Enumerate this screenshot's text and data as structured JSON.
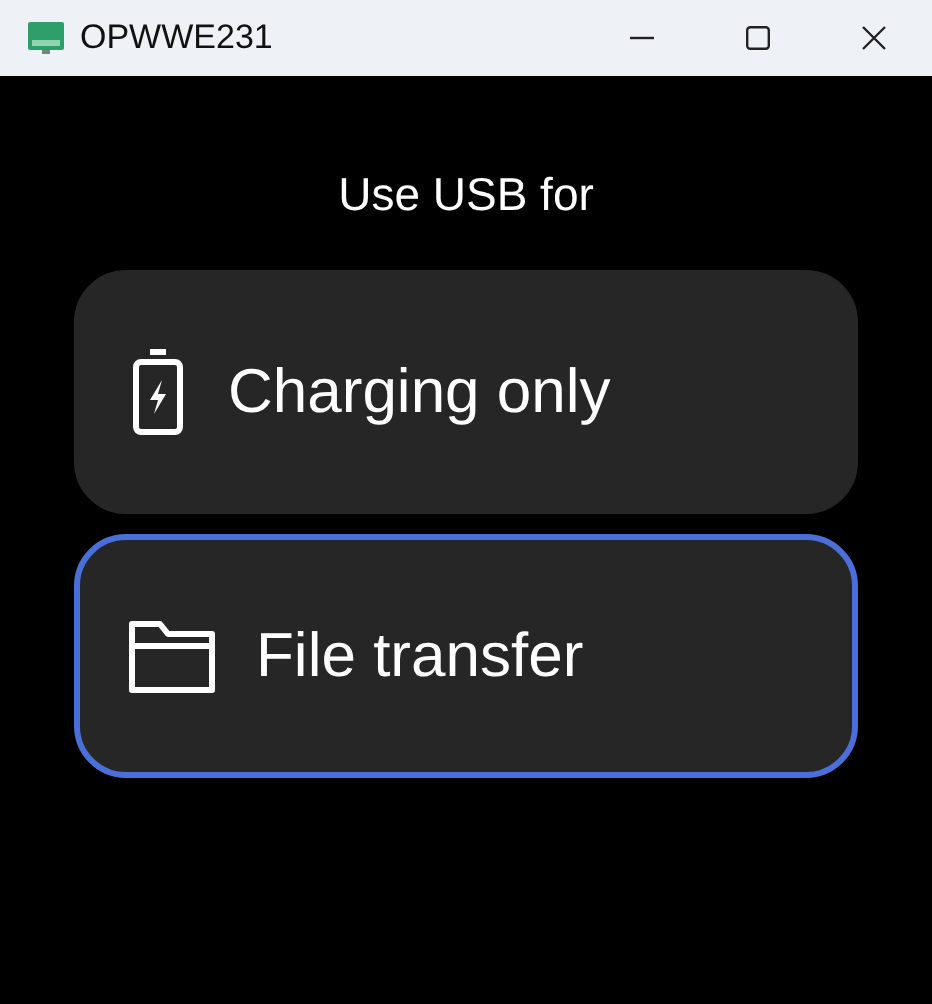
{
  "window": {
    "title": "OPWWE231"
  },
  "heading": "Use USB for",
  "options": [
    {
      "kind": "charging",
      "label": "Charging only",
      "selected": false
    },
    {
      "kind": "files",
      "label": "File transfer",
      "selected": true
    }
  ]
}
